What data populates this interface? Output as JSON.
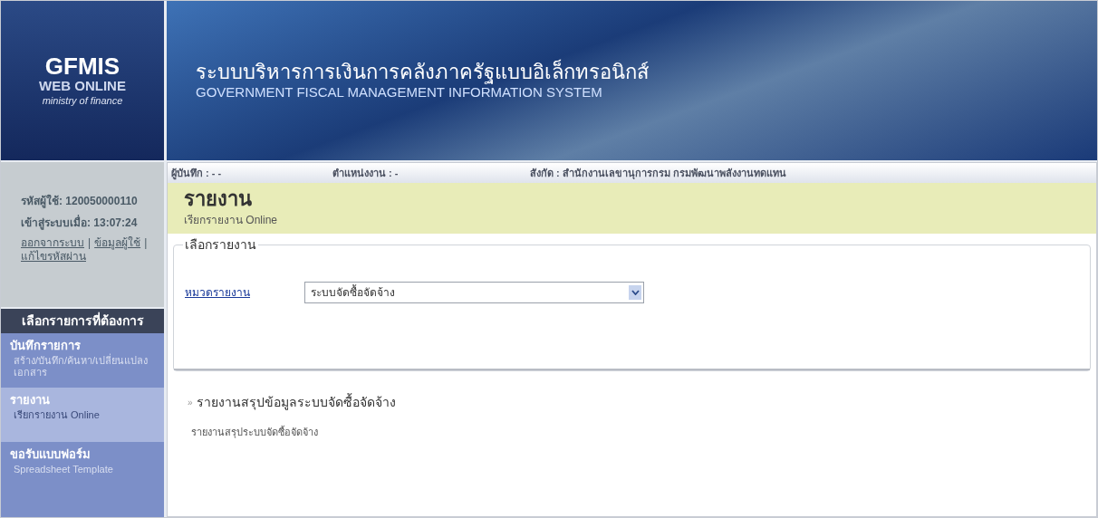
{
  "logo": {
    "title": "GFMIS",
    "subtitle": "WEB ONLINE",
    "tagline": "ministry of finance"
  },
  "banner": {
    "title_th": "ระบบบริหารการเงินการคลังภาครัฐแบบอิเล็กทรอนิกส์",
    "title_en": "GOVERNMENT FISCAL MANAGEMENT INFORMATION SYSTEM"
  },
  "user_panel": {
    "user_id_label": "รหัสผู้ใช้:",
    "user_id": "120050000110",
    "login_label": "เข้าสู่ระบบเมื่อ:",
    "login_time": "13:07:24",
    "links": [
      "ออกจากระบบ",
      "ข้อมูลผู้ใช้",
      "แก้ไขรหัสผ่าน"
    ],
    "separator": "|"
  },
  "menu": {
    "header": "เลือกรายการที่ต้องการ",
    "items": [
      {
        "title": "บันทึกรายการ",
        "subtitle": "สร้าง/บันทึก/ค้นหา/เปลี่ยนแปลง เอกสาร",
        "selected": false
      },
      {
        "title": "รายงาน",
        "subtitle": "เรียกรายงาน Online",
        "selected": true
      },
      {
        "title": "ขอรับแบบฟอร์ม",
        "subtitle": "Spreadsheet Template",
        "selected": false
      }
    ]
  },
  "info_bar": [
    {
      "label": "ผู้บันทึก :",
      "value": "- -"
    },
    {
      "label": "ตำแหน่งงาน :",
      "value": "-"
    },
    {
      "label": "สังกัด :",
      "value": "สำนักงานเลขานุการกรม กรมพัฒนาพลังงานทดแทน"
    }
  ],
  "page": {
    "title": "รายงาน",
    "subtitle": "เรียกรายงาน Online"
  },
  "report_form": {
    "legend": "เลือกรายงาน",
    "field_label": "หมวดรายงาน",
    "select_value": "ระบบจัดซื้อจัดจ้าง"
  },
  "reports": [
    {
      "bullet": "»",
      "title": "รายงานสรุปข้อมูลระบบจัดซื้อจัดจ้าง",
      "description": "รายงานสรุประบบจัดซื้อจัดจ้าง"
    }
  ]
}
